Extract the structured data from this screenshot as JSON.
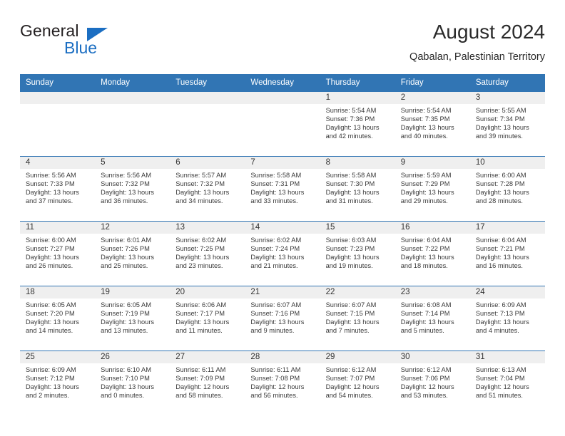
{
  "brand": {
    "name_part1": "General",
    "name_part2": "Blue",
    "accent_color": "#1b6ec2",
    "triangle_icon": "brand-triangle-icon"
  },
  "header": {
    "title": "August 2024",
    "subtitle": "Qabalan, Palestinian Territory"
  },
  "calendar": {
    "header_background": "#3175b4",
    "daynum_background": "#efefef",
    "weekday_headers": [
      "Sunday",
      "Monday",
      "Tuesday",
      "Wednesday",
      "Thursday",
      "Friday",
      "Saturday"
    ],
    "weeks": [
      [
        {
          "day": "",
          "sunrise": "",
          "sunset": "",
          "daylight_line1": "",
          "daylight_line2": ""
        },
        {
          "day": "",
          "sunrise": "",
          "sunset": "",
          "daylight_line1": "",
          "daylight_line2": ""
        },
        {
          "day": "",
          "sunrise": "",
          "sunset": "",
          "daylight_line1": "",
          "daylight_line2": ""
        },
        {
          "day": "",
          "sunrise": "",
          "sunset": "",
          "daylight_line1": "",
          "daylight_line2": ""
        },
        {
          "day": "1",
          "sunrise": "Sunrise: 5:54 AM",
          "sunset": "Sunset: 7:36 PM",
          "daylight_line1": "Daylight: 13 hours",
          "daylight_line2": "and 42 minutes."
        },
        {
          "day": "2",
          "sunrise": "Sunrise: 5:54 AM",
          "sunset": "Sunset: 7:35 PM",
          "daylight_line1": "Daylight: 13 hours",
          "daylight_line2": "and 40 minutes."
        },
        {
          "day": "3",
          "sunrise": "Sunrise: 5:55 AM",
          "sunset": "Sunset: 7:34 PM",
          "daylight_line1": "Daylight: 13 hours",
          "daylight_line2": "and 39 minutes."
        }
      ],
      [
        {
          "day": "4",
          "sunrise": "Sunrise: 5:56 AM",
          "sunset": "Sunset: 7:33 PM",
          "daylight_line1": "Daylight: 13 hours",
          "daylight_line2": "and 37 minutes."
        },
        {
          "day": "5",
          "sunrise": "Sunrise: 5:56 AM",
          "sunset": "Sunset: 7:32 PM",
          "daylight_line1": "Daylight: 13 hours",
          "daylight_line2": "and 36 minutes."
        },
        {
          "day": "6",
          "sunrise": "Sunrise: 5:57 AM",
          "sunset": "Sunset: 7:32 PM",
          "daylight_line1": "Daylight: 13 hours",
          "daylight_line2": "and 34 minutes."
        },
        {
          "day": "7",
          "sunrise": "Sunrise: 5:58 AM",
          "sunset": "Sunset: 7:31 PM",
          "daylight_line1": "Daylight: 13 hours",
          "daylight_line2": "and 33 minutes."
        },
        {
          "day": "8",
          "sunrise": "Sunrise: 5:58 AM",
          "sunset": "Sunset: 7:30 PM",
          "daylight_line1": "Daylight: 13 hours",
          "daylight_line2": "and 31 minutes."
        },
        {
          "day": "9",
          "sunrise": "Sunrise: 5:59 AM",
          "sunset": "Sunset: 7:29 PM",
          "daylight_line1": "Daylight: 13 hours",
          "daylight_line2": "and 29 minutes."
        },
        {
          "day": "10",
          "sunrise": "Sunrise: 6:00 AM",
          "sunset": "Sunset: 7:28 PM",
          "daylight_line1": "Daylight: 13 hours",
          "daylight_line2": "and 28 minutes."
        }
      ],
      [
        {
          "day": "11",
          "sunrise": "Sunrise: 6:00 AM",
          "sunset": "Sunset: 7:27 PM",
          "daylight_line1": "Daylight: 13 hours",
          "daylight_line2": "and 26 minutes."
        },
        {
          "day": "12",
          "sunrise": "Sunrise: 6:01 AM",
          "sunset": "Sunset: 7:26 PM",
          "daylight_line1": "Daylight: 13 hours",
          "daylight_line2": "and 25 minutes."
        },
        {
          "day": "13",
          "sunrise": "Sunrise: 6:02 AM",
          "sunset": "Sunset: 7:25 PM",
          "daylight_line1": "Daylight: 13 hours",
          "daylight_line2": "and 23 minutes."
        },
        {
          "day": "14",
          "sunrise": "Sunrise: 6:02 AM",
          "sunset": "Sunset: 7:24 PM",
          "daylight_line1": "Daylight: 13 hours",
          "daylight_line2": "and 21 minutes."
        },
        {
          "day": "15",
          "sunrise": "Sunrise: 6:03 AM",
          "sunset": "Sunset: 7:23 PM",
          "daylight_line1": "Daylight: 13 hours",
          "daylight_line2": "and 19 minutes."
        },
        {
          "day": "16",
          "sunrise": "Sunrise: 6:04 AM",
          "sunset": "Sunset: 7:22 PM",
          "daylight_line1": "Daylight: 13 hours",
          "daylight_line2": "and 18 minutes."
        },
        {
          "day": "17",
          "sunrise": "Sunrise: 6:04 AM",
          "sunset": "Sunset: 7:21 PM",
          "daylight_line1": "Daylight: 13 hours",
          "daylight_line2": "and 16 minutes."
        }
      ],
      [
        {
          "day": "18",
          "sunrise": "Sunrise: 6:05 AM",
          "sunset": "Sunset: 7:20 PM",
          "daylight_line1": "Daylight: 13 hours",
          "daylight_line2": "and 14 minutes."
        },
        {
          "day": "19",
          "sunrise": "Sunrise: 6:05 AM",
          "sunset": "Sunset: 7:19 PM",
          "daylight_line1": "Daylight: 13 hours",
          "daylight_line2": "and 13 minutes."
        },
        {
          "day": "20",
          "sunrise": "Sunrise: 6:06 AM",
          "sunset": "Sunset: 7:17 PM",
          "daylight_line1": "Daylight: 13 hours",
          "daylight_line2": "and 11 minutes."
        },
        {
          "day": "21",
          "sunrise": "Sunrise: 6:07 AM",
          "sunset": "Sunset: 7:16 PM",
          "daylight_line1": "Daylight: 13 hours",
          "daylight_line2": "and 9 minutes."
        },
        {
          "day": "22",
          "sunrise": "Sunrise: 6:07 AM",
          "sunset": "Sunset: 7:15 PM",
          "daylight_line1": "Daylight: 13 hours",
          "daylight_line2": "and 7 minutes."
        },
        {
          "day": "23",
          "sunrise": "Sunrise: 6:08 AM",
          "sunset": "Sunset: 7:14 PM",
          "daylight_line1": "Daylight: 13 hours",
          "daylight_line2": "and 5 minutes."
        },
        {
          "day": "24",
          "sunrise": "Sunrise: 6:09 AM",
          "sunset": "Sunset: 7:13 PM",
          "daylight_line1": "Daylight: 13 hours",
          "daylight_line2": "and 4 minutes."
        }
      ],
      [
        {
          "day": "25",
          "sunrise": "Sunrise: 6:09 AM",
          "sunset": "Sunset: 7:12 PM",
          "daylight_line1": "Daylight: 13 hours",
          "daylight_line2": "and 2 minutes."
        },
        {
          "day": "26",
          "sunrise": "Sunrise: 6:10 AM",
          "sunset": "Sunset: 7:10 PM",
          "daylight_line1": "Daylight: 13 hours",
          "daylight_line2": "and 0 minutes."
        },
        {
          "day": "27",
          "sunrise": "Sunrise: 6:11 AM",
          "sunset": "Sunset: 7:09 PM",
          "daylight_line1": "Daylight: 12 hours",
          "daylight_line2": "and 58 minutes."
        },
        {
          "day": "28",
          "sunrise": "Sunrise: 6:11 AM",
          "sunset": "Sunset: 7:08 PM",
          "daylight_line1": "Daylight: 12 hours",
          "daylight_line2": "and 56 minutes."
        },
        {
          "day": "29",
          "sunrise": "Sunrise: 6:12 AM",
          "sunset": "Sunset: 7:07 PM",
          "daylight_line1": "Daylight: 12 hours",
          "daylight_line2": "and 54 minutes."
        },
        {
          "day": "30",
          "sunrise": "Sunrise: 6:12 AM",
          "sunset": "Sunset: 7:06 PM",
          "daylight_line1": "Daylight: 12 hours",
          "daylight_line2": "and 53 minutes."
        },
        {
          "day": "31",
          "sunrise": "Sunrise: 6:13 AM",
          "sunset": "Sunset: 7:04 PM",
          "daylight_line1": "Daylight: 12 hours",
          "daylight_line2": "and 51 minutes."
        }
      ]
    ]
  }
}
